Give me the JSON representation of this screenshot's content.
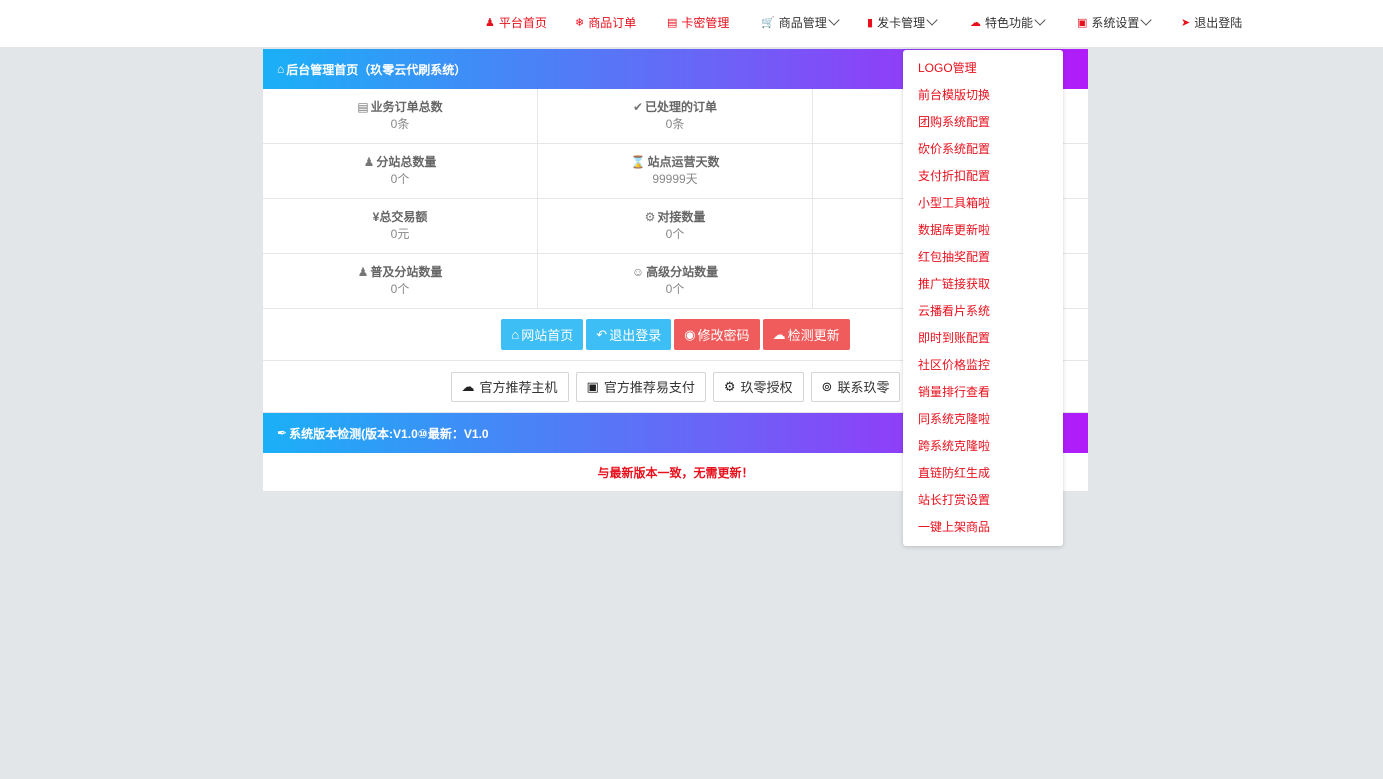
{
  "nav": {
    "home": "平台首页",
    "orders": "商品订单",
    "cardkeys": "卡密管理",
    "goods_mgmt": "商品管理",
    "issue_cards": "发卡管理",
    "features": "特色功能",
    "settings": "系统设置",
    "logout": "退出登陆"
  },
  "panel": {
    "title": "后台管理首页（玖零云代刷系统）"
  },
  "stats": [
    [
      {
        "title": "业务订单总数",
        "value": "0条"
      },
      {
        "title": "已处理的订单",
        "value": "0条"
      },
      {
        "title": "",
        "value": ""
      }
    ],
    [
      {
        "title": "分站总数量",
        "value": "0个"
      },
      {
        "title": "站点运营天数",
        "value": "99999天"
      },
      {
        "title": "",
        "value": ""
      }
    ],
    [
      {
        "title": "¥总交易额",
        "value": "0元"
      },
      {
        "title": "对接数量",
        "value": "0个"
      },
      {
        "title": "",
        "value": ""
      }
    ],
    [
      {
        "title": "普及分站数量",
        "value": "0个"
      },
      {
        "title": "高级分站数量",
        "value": "0个"
      },
      {
        "title": "",
        "value": ""
      }
    ]
  ],
  "buttons": {
    "site_home": "网站首页",
    "logout": "退出登录",
    "change_password": "修改密码",
    "check_update": "检测更新"
  },
  "links": {
    "host": "官方推荐主机",
    "pay": "官方推荐易支付",
    "auth": "玖零授权",
    "contact": "联系玖零"
  },
  "version_panel": {
    "title": "系统版本检测(版本:V1.0⑩最新：V1.0",
    "message": "与最新版本一致，无需更新！"
  },
  "dropdown": {
    "items": [
      "LOGO管理",
      "前台模版切换",
      "团购系统配置",
      "砍价系统配置",
      "支付折扣配置",
      "小型工具箱啦",
      "数据库更新啦",
      "红包抽奖配置",
      "推广链接获取",
      "云播看片系统",
      "即时到账配置",
      "社区价格监控",
      "销量排行查看",
      "同系统克隆啦",
      "跨系统克隆啦",
      "直链防红生成",
      "站长打赏设置",
      "一键上架商品"
    ]
  },
  "colors": {
    "accent_red": "#e8101c",
    "header_gradient_start": "#1ab0f7",
    "header_gradient_end": "#b11bf9",
    "btn_blue": "#3dbef5",
    "btn_red": "#f05c5c"
  }
}
